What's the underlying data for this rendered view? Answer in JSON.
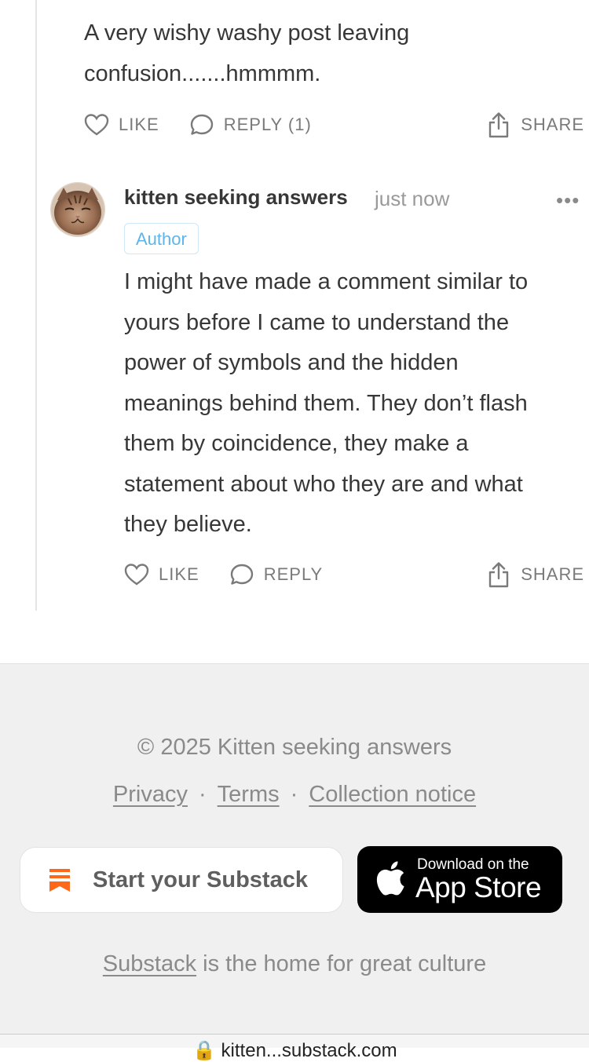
{
  "parent_comment": {
    "text_line1": "A very wishy washy post leaving",
    "text_line2": "confusion.......hmmmm.",
    "like_label": "LIKE",
    "reply_label": "REPLY (1)",
    "share_label": "SHARE"
  },
  "reply_comment": {
    "username": "kitten seeking answers",
    "timestamp": "just now",
    "more": "•••",
    "badge": "Author",
    "lines": [
      "I might have made a comment similar to",
      "yours before I came to understand the",
      "power of symbols and the hidden",
      "meanings behind them. They don’t flash",
      "them by coincidence, they make a",
      "statement about who they are and what",
      "they believe."
    ],
    "like_label": "LIKE",
    "reply_label": "REPLY",
    "share_label": "SHARE"
  },
  "footer": {
    "copyright": "© 2025 Kitten seeking answers",
    "links": {
      "privacy": "Privacy",
      "terms": "Terms",
      "collection": "Collection notice",
      "separator": "·"
    },
    "start_button": "Start your Substack",
    "app_store": {
      "small": "Download on the",
      "big": "App Store"
    },
    "tagline_link": "Substack",
    "tagline_rest": " is the home for great culture"
  },
  "bottom_bar": {
    "url_partial": "🔒 kitten...substack.com"
  },
  "colors": {
    "brand_orange": "#ff6719",
    "author_blue": "#5db5ea",
    "footer_bg": "#f0f0f0"
  },
  "icons": [
    "heart-icon",
    "comment-bubble-icon",
    "share-icon",
    "substack-logo-icon",
    "apple-icon"
  ]
}
